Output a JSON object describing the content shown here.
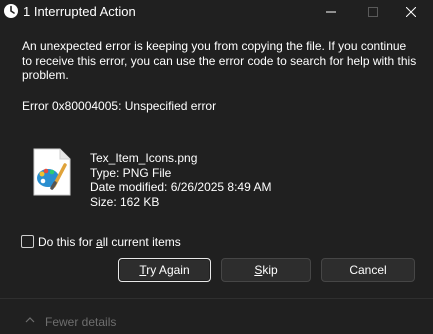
{
  "window": {
    "title": "1 Interrupted Action"
  },
  "dialog": {
    "message": "An unexpected error is keeping you from copying the file. If you continue to receive this error, you can use the error code to search for help with this problem.",
    "error_code": "Error 0x80004005: Unspecified error"
  },
  "file": {
    "icon": "paint-palette-file-icon",
    "name": "Tex_Item_Icons.png",
    "type": "Type: PNG File",
    "date_modified": "Date modified: 6/26/2025 8:49 AM",
    "size": "Size: 162 KB"
  },
  "checkbox": {
    "label_before": "Do this for ",
    "label_underlined": "a",
    "label_after": "ll current items",
    "checked": false
  },
  "buttons": {
    "try_again_underlined": "T",
    "try_again_rest": "ry Again",
    "skip_underlined": "S",
    "skip_rest": "kip",
    "cancel": "Cancel"
  },
  "footer": {
    "toggle_label": "Fewer details"
  },
  "colors": {
    "background": "#202020",
    "button_bg": "#2d2d2d",
    "button_border": "#464646",
    "default_border": "#e8e8e8",
    "disabled_text": "#6e6e6e"
  }
}
